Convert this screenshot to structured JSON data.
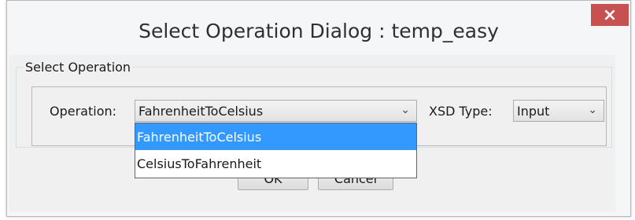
{
  "dialog": {
    "title": "Select Operation Dialog : temp_easy",
    "close_glyph": "×",
    "group_label": "Select Operation",
    "operation_label": "Operation:",
    "operation_value": "FahrenheitToCelsius",
    "xsd_label": "XSD Type:",
    "xsd_value": "Input",
    "chevron_glyph": "⌄",
    "ok_label": "OK",
    "cancel_label": "Cancel",
    "options": [
      "FahrenheitToCelsius",
      "CelsiusToFahrenheit"
    ]
  },
  "colors": {
    "close_bg": "#c75050",
    "selection_bg": "#3399ff"
  }
}
